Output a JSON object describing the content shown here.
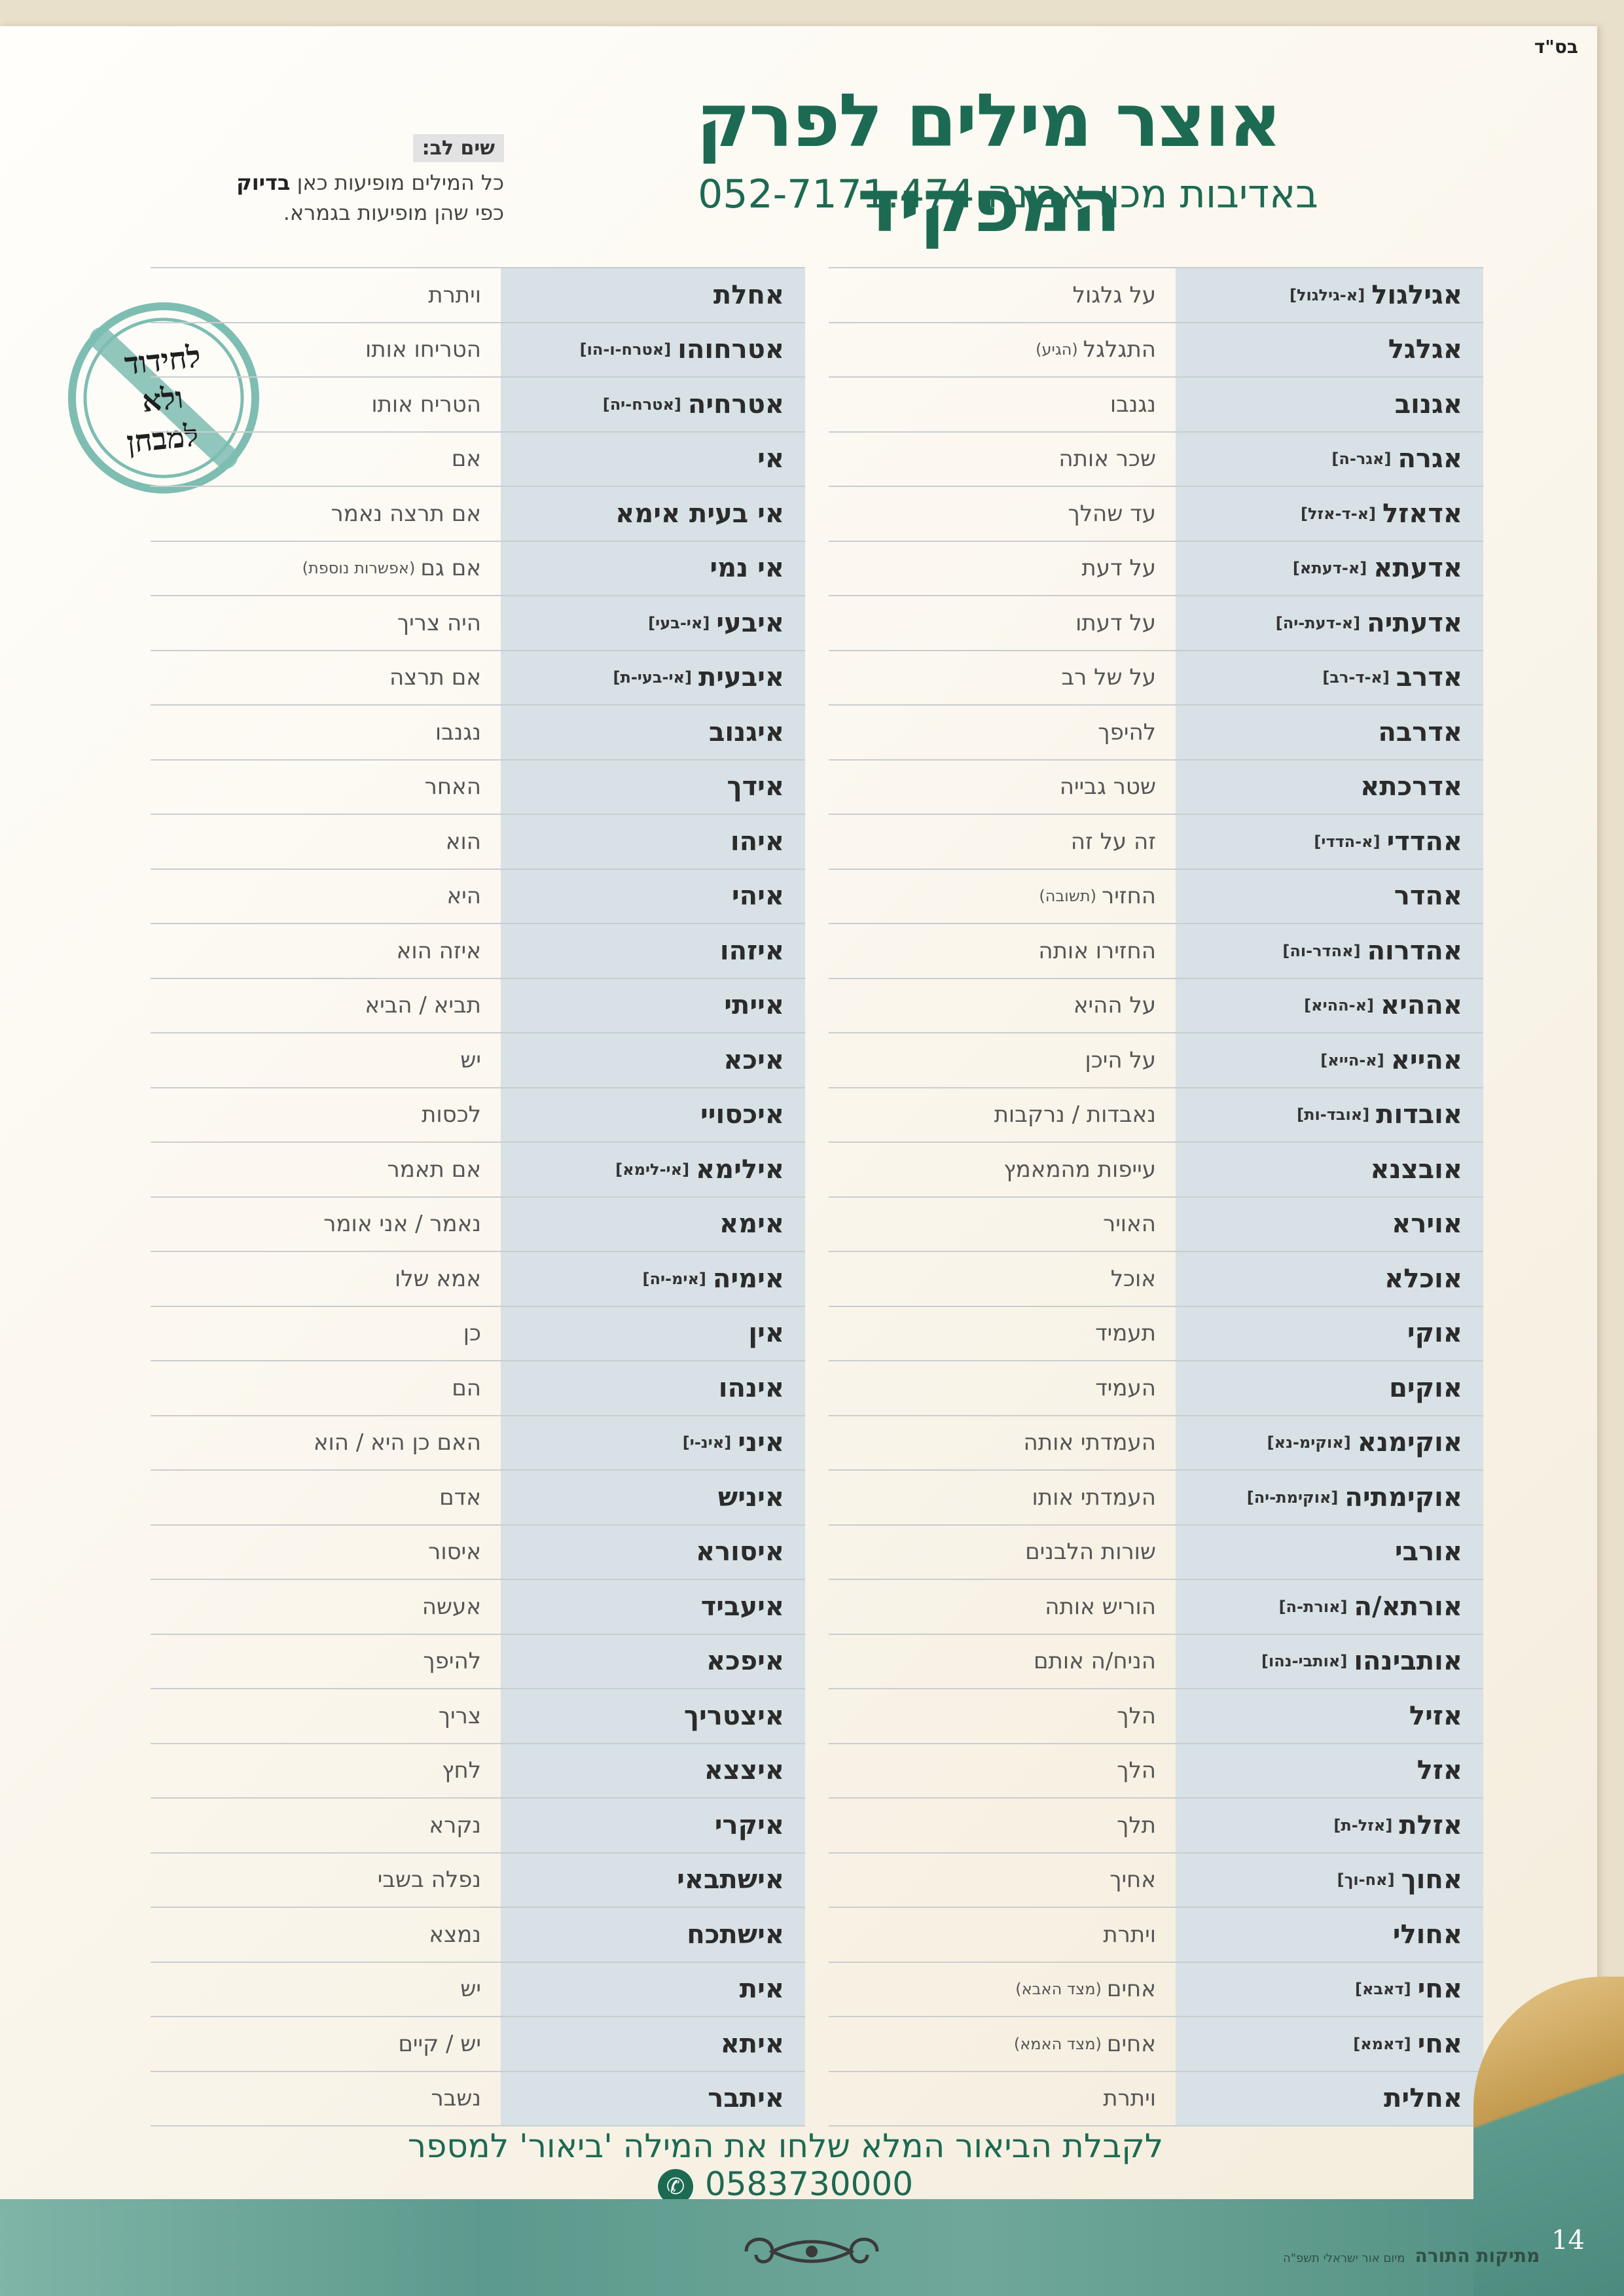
{
  "header": {
    "bsd": "בס\"ד",
    "title": "אוצר מילים לפרק המפקיד",
    "subtitle": "באדיבות מכון אבינה 052-7171.474"
  },
  "note": {
    "heading": "שים לב:",
    "line1_prefix": "כל המילים מופיעות כאן ",
    "line1_bold": "בדיוק",
    "line2": "כפי שהן מופיעות בגמרא."
  },
  "stamp": {
    "line1": "לחידוד",
    "line2": "ולא",
    "line3": "למבחן"
  },
  "right_column": [
    {
      "word": "אגילגול",
      "hint": "[א-גילגול]",
      "meaning": "על גלגול",
      "meaning_note": ""
    },
    {
      "word": "אגלגל",
      "hint": "",
      "meaning": "התגלגל",
      "meaning_note": "(הגיע)"
    },
    {
      "word": "אגנוב",
      "hint": "",
      "meaning": "נגנבו",
      "meaning_note": ""
    },
    {
      "word": "אגרה",
      "hint": "[אגר-ה]",
      "meaning": "שכר אותה",
      "meaning_note": ""
    },
    {
      "word": "אדאזל",
      "hint": "[א-ד-אזל]",
      "meaning": "עד שהלך",
      "meaning_note": ""
    },
    {
      "word": "אדעתא",
      "hint": "[א-דעתא]",
      "meaning": "על דעת",
      "meaning_note": ""
    },
    {
      "word": "אדעתיה",
      "hint": "[א-דעת-יה]",
      "meaning": "על דעתו",
      "meaning_note": ""
    },
    {
      "word": "אדרב",
      "hint": "[א-ד-רב]",
      "meaning": "על של רב",
      "meaning_note": ""
    },
    {
      "word": "אדרבה",
      "hint": "",
      "meaning": "להיפך",
      "meaning_note": ""
    },
    {
      "word": "אדרכתא",
      "hint": "",
      "meaning": "שטר גבייה",
      "meaning_note": ""
    },
    {
      "word": "אהדדי",
      "hint": "[א-הדדי]",
      "meaning": "זה על זה",
      "meaning_note": ""
    },
    {
      "word": "אהדר",
      "hint": "",
      "meaning": "החזיר",
      "meaning_note": "(תשובה)"
    },
    {
      "word": "אהדרוה",
      "hint": "[אהדר-וה]",
      "meaning": "החזירו אותה",
      "meaning_note": ""
    },
    {
      "word": "אההיא",
      "hint": "[א-ההיא]",
      "meaning": "על ההיא",
      "meaning_note": ""
    },
    {
      "word": "אהייא",
      "hint": "[א-הייא]",
      "meaning": "על היכן",
      "meaning_note": ""
    },
    {
      "word": "אובדות",
      "hint": "[אובד-ות]",
      "meaning": "נאבדות / נרקבות",
      "meaning_note": ""
    },
    {
      "word": "אובצנא",
      "hint": "",
      "meaning": "עייפות מהמאמץ",
      "meaning_note": ""
    },
    {
      "word": "אוירא",
      "hint": "",
      "meaning": "האויר",
      "meaning_note": ""
    },
    {
      "word": "אוכלא",
      "hint": "",
      "meaning": "אוכל",
      "meaning_note": ""
    },
    {
      "word": "אוקי",
      "hint": "",
      "meaning": "תעמיד",
      "meaning_note": ""
    },
    {
      "word": "אוקים",
      "hint": "",
      "meaning": "העמיד",
      "meaning_note": ""
    },
    {
      "word": "אוקימנא",
      "hint": "[אוקימ-נא]",
      "meaning": "העמדתי אותה",
      "meaning_note": ""
    },
    {
      "word": "אוקימתיה",
      "hint": "[אוקימת-יה]",
      "meaning": "העמדתי אותו",
      "meaning_note": ""
    },
    {
      "word": "אורבי",
      "hint": "",
      "meaning": "שורות הלבנים",
      "meaning_note": ""
    },
    {
      "word": "אורתא/ה",
      "hint": "[אורת-ה]",
      "meaning": "הוריש אותה",
      "meaning_note": ""
    },
    {
      "word": "אותבינהו",
      "hint": "[אותבי-נהו]",
      "meaning": "הניח/ה אותם",
      "meaning_note": ""
    },
    {
      "word": "אזיל",
      "hint": "",
      "meaning": "הלך",
      "meaning_note": ""
    },
    {
      "word": "אזל",
      "hint": "",
      "meaning": "הלך",
      "meaning_note": ""
    },
    {
      "word": "אזלת",
      "hint": "[אזל-ת]",
      "meaning": "תלך",
      "meaning_note": ""
    },
    {
      "word": "אחוך",
      "hint": "[אח-וך]",
      "meaning": "אחיך",
      "meaning_note": ""
    },
    {
      "word": "אחולי",
      "hint": "",
      "meaning": "ויתרת",
      "meaning_note": ""
    },
    {
      "word": "אחי",
      "hint": "[דאבא]",
      "meaning": "אחים",
      "meaning_note": "(מצד האבא)"
    },
    {
      "word": "אחי",
      "hint": "[דאמא]",
      "meaning": "אחים",
      "meaning_note": "(מצד האמא)"
    },
    {
      "word": "אחלית",
      "hint": "",
      "meaning": "ויתרת",
      "meaning_note": ""
    }
  ],
  "left_column": [
    {
      "word": "אחלת",
      "hint": "",
      "meaning": "ויתרת",
      "meaning_note": ""
    },
    {
      "word": "אטרחוהו",
      "hint": "[אטרח-ו-הו]",
      "meaning": "הטריחו אותו",
      "meaning_note": ""
    },
    {
      "word": "אטרחיה",
      "hint": "[אטרח-יה]",
      "meaning": "הטריח אותו",
      "meaning_note": ""
    },
    {
      "word": "אי",
      "hint": "",
      "meaning": "אם",
      "meaning_note": ""
    },
    {
      "word": "אי בעית אימא",
      "hint": "",
      "meaning": "אם תרצה נאמר",
      "meaning_note": ""
    },
    {
      "word": "אי נמי",
      "hint": "",
      "meaning": "אם גם",
      "meaning_note": "(אפשרות נוספת)"
    },
    {
      "word": "איבעי",
      "hint": "[אי-בעי]",
      "meaning": "היה צריך",
      "meaning_note": ""
    },
    {
      "word": "איבעית",
      "hint": "[אי-בעי-ת]",
      "meaning": "אם תרצה",
      "meaning_note": ""
    },
    {
      "word": "איגנוב",
      "hint": "",
      "meaning": "נגנבו",
      "meaning_note": ""
    },
    {
      "word": "אידך",
      "hint": "",
      "meaning": "האחר",
      "meaning_note": ""
    },
    {
      "word": "איהו",
      "hint": "",
      "meaning": "הוא",
      "meaning_note": ""
    },
    {
      "word": "איהי",
      "hint": "",
      "meaning": "היא",
      "meaning_note": ""
    },
    {
      "word": "איזהו",
      "hint": "",
      "meaning": "איזה הוא",
      "meaning_note": ""
    },
    {
      "word": "אייתי",
      "hint": "",
      "meaning": "תביא / הביא",
      "meaning_note": ""
    },
    {
      "word": "איכא",
      "hint": "",
      "meaning": "יש",
      "meaning_note": ""
    },
    {
      "word": "איכסויי",
      "hint": "",
      "meaning": "לכסות",
      "meaning_note": ""
    },
    {
      "word": "אילימא",
      "hint": "[אי-לימא]",
      "meaning": "אם תאמר",
      "meaning_note": ""
    },
    {
      "word": "אימא",
      "hint": "",
      "meaning": "נאמר / אני אומר",
      "meaning_note": ""
    },
    {
      "word": "אימיה",
      "hint": "[אימ-יה]",
      "meaning": "אמא שלו",
      "meaning_note": ""
    },
    {
      "word": "אין",
      "hint": "",
      "meaning": "כן",
      "meaning_note": ""
    },
    {
      "word": "אינהו",
      "hint": "",
      "meaning": "הם",
      "meaning_note": ""
    },
    {
      "word": "איני",
      "hint": "[אינ-י]",
      "meaning": "האם כן היא / הוא",
      "meaning_note": ""
    },
    {
      "word": "איניש",
      "hint": "",
      "meaning": "אדם",
      "meaning_note": ""
    },
    {
      "word": "איסורא",
      "hint": "",
      "meaning": "איסור",
      "meaning_note": ""
    },
    {
      "word": "איעביד",
      "hint": "",
      "meaning": "אעשה",
      "meaning_note": ""
    },
    {
      "word": "איפכא",
      "hint": "",
      "meaning": "להיפך",
      "meaning_note": ""
    },
    {
      "word": "איצטריך",
      "hint": "",
      "meaning": "צריך",
      "meaning_note": ""
    },
    {
      "word": "איצצא",
      "hint": "",
      "meaning": "לחץ",
      "meaning_note": ""
    },
    {
      "word": "איקרי",
      "hint": "",
      "meaning": "נקרא",
      "meaning_note": ""
    },
    {
      "word": "אישתבאי",
      "hint": "",
      "meaning": "נפלה בשבי",
      "meaning_note": ""
    },
    {
      "word": "אישתכח",
      "hint": "",
      "meaning": "נמצא",
      "meaning_note": ""
    },
    {
      "word": "אית",
      "hint": "",
      "meaning": "יש",
      "meaning_note": ""
    },
    {
      "word": "איתא",
      "hint": "",
      "meaning": "יש / קיים",
      "meaning_note": ""
    },
    {
      "word": "איתבר",
      "hint": "",
      "meaning": "נשבר",
      "meaning_note": ""
    }
  ],
  "footer": {
    "text": "לקבלת הביאור המלא שלחו את המילה 'ביאור' למספר 0583730000"
  },
  "bottom": {
    "page_number": "14",
    "logo": "מתיקות התורה",
    "credit": "מיום אור ישראלי תשפ\"ה"
  },
  "colors": {
    "accent": "#1d6a52",
    "word_bg": "#d7e1e6",
    "stamp": "#7dbdb2"
  }
}
